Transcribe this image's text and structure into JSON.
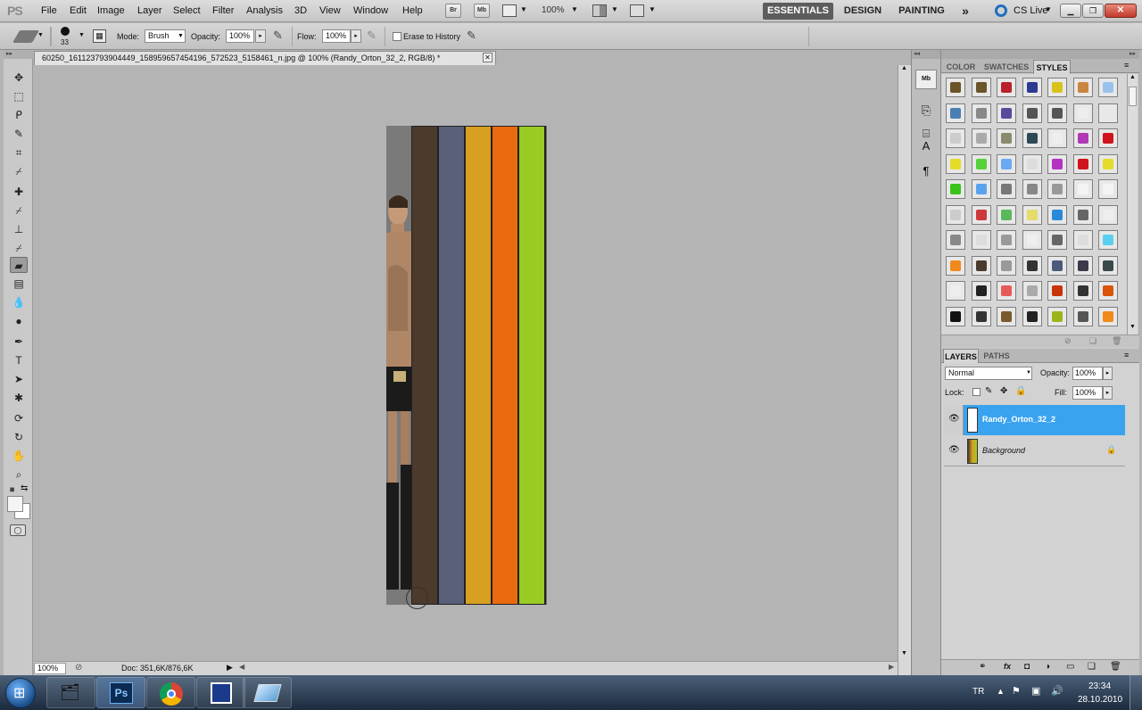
{
  "app": {
    "logo": "PS",
    "menus": [
      "File",
      "Edit",
      "Image",
      "Layer",
      "Select",
      "Filter",
      "Analysis",
      "3D",
      "View",
      "Window",
      "Help"
    ],
    "bridge_label": "Br",
    "minibridge_label": "Mb",
    "zoom_display": "100%",
    "workspaces": [
      "ESSENTIALS",
      "DESIGN",
      "PAINTING"
    ],
    "workspace_more": "»",
    "cslive_label": "CS Live"
  },
  "options": {
    "brush_size": "33",
    "mode_label": "Mode:",
    "mode_value": "Brush",
    "opacity_label": "Opacity:",
    "opacity_value": "100%",
    "flow_label": "Flow:",
    "flow_value": "100%",
    "erase_history_label": "Erase to History"
  },
  "document": {
    "tab_title": "60250_161123793904449_158959657454196_572523_5158461_n.jpg @ 100% (Randy_Orton_32_2, RGB/8) *",
    "zoom": "100%",
    "doc_size": "Doc: 351,6K/876,6K",
    "stripe_colors": [
      "#4c3a2c",
      "#5a6079",
      "#d8a021",
      "#ea6a10",
      "#9acb24"
    ]
  },
  "panels": {
    "style_tabs": [
      "COLOR",
      "SWATCHES",
      "STYLES"
    ],
    "layers_tabs": [
      "LAYERS",
      "PATHS"
    ],
    "blend_mode": "Normal",
    "opacity_label": "Opacity:",
    "opacity_value": "100%",
    "lock_label": "Lock:",
    "fill_label": "Fill:",
    "fill_value": "100%",
    "layers": [
      {
        "name": "Randy_Orton_32_2",
        "selected": true
      },
      {
        "name": "Background",
        "selected": false
      }
    ]
  },
  "taskbar": {
    "lang": "TR",
    "time": "23:34",
    "date": "28.10.2010",
    "ps_label": "Ps"
  },
  "colors": {
    "accent": "#3aa3f0",
    "canvas_bg": "#b4b4b4"
  }
}
